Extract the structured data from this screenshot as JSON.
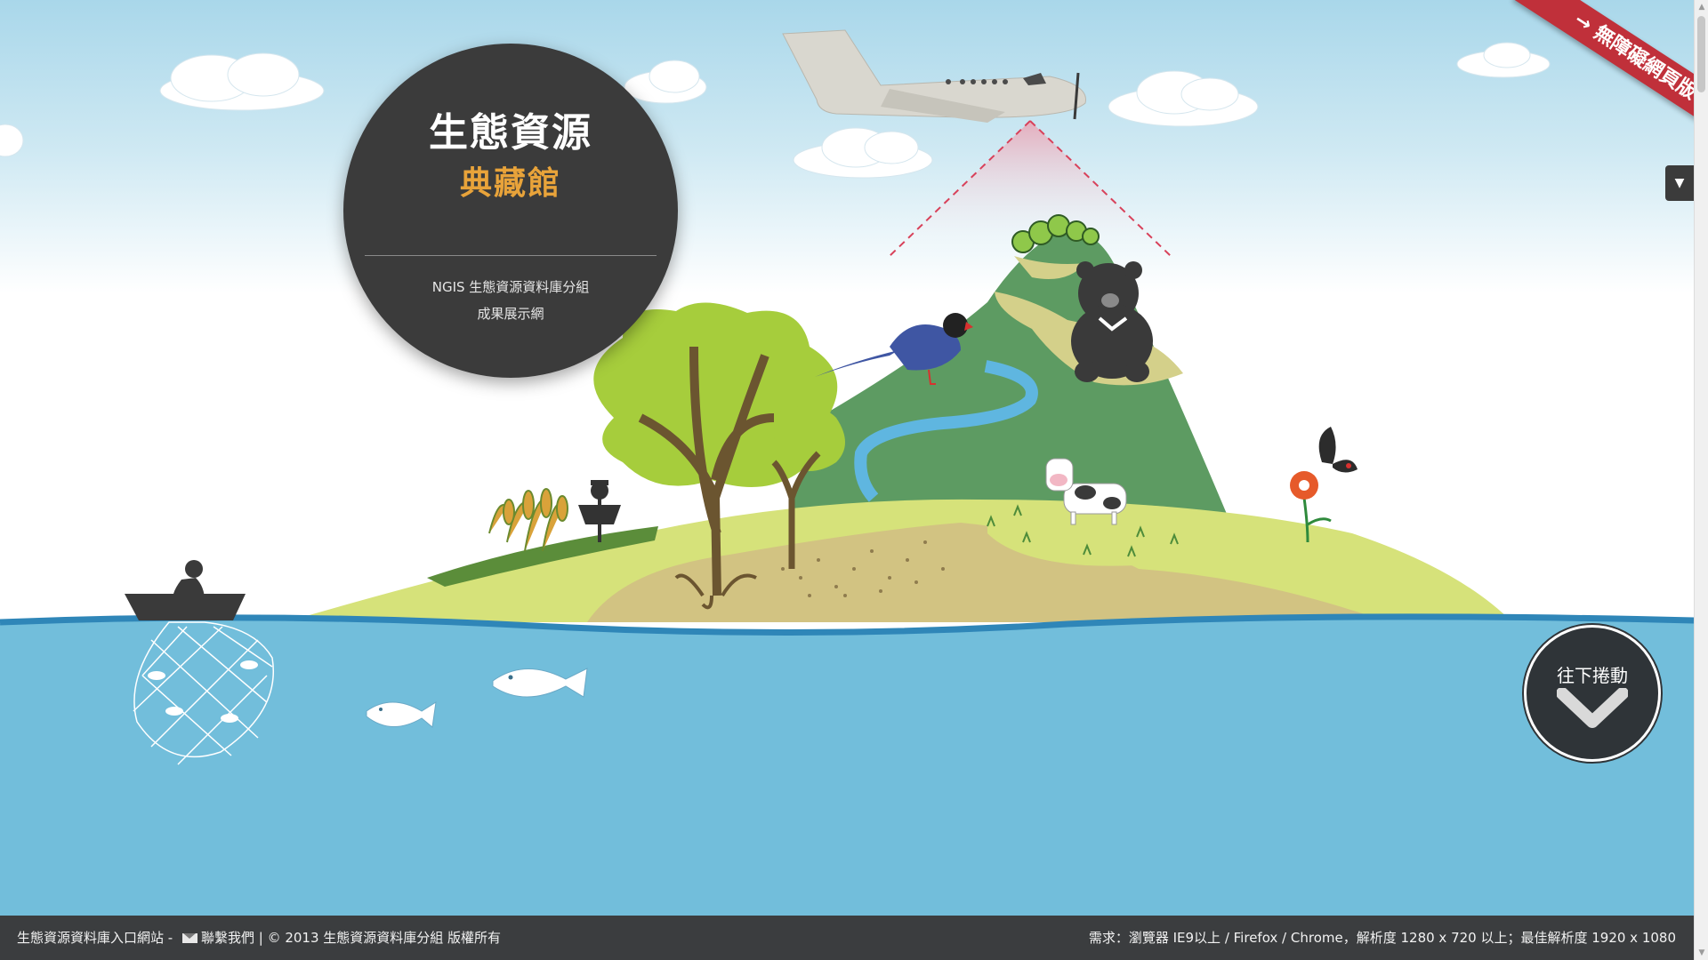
{
  "title": {
    "main": "生態資源",
    "sub": "典藏館",
    "desc_line1": "NGIS 生態資源資料庫分組",
    "desc_line2": "成果展示網"
  },
  "ribbon": {
    "label": "無障礙網頁版",
    "arrow": "→"
  },
  "side_tab": {
    "icon": "▼"
  },
  "scroll_button": {
    "label": "往下捲動",
    "icon": "chevron-down-icon"
  },
  "footer": {
    "portal_link": "生態資源資料庫入口網站",
    "separator1": " - ",
    "contact_link": "聯繫我們",
    "separator2": " | ",
    "copyright": "© 2013 生態資源資料庫分組 版權所有",
    "requirements": "需求：瀏覽器 IE9以上 / Firefox / Chrome，解析度 1280 x 720 以上；最佳解析度 1920 x 1080"
  },
  "colors": {
    "sea": "#72bedb",
    "sea_line": "#2f86b8",
    "title_bg": "#3b3b3b",
    "title_accent": "#e8a33a",
    "ribbon": "#c0303a",
    "footer_bg": "#3b3d3f",
    "island_light": "#d6e27a",
    "island_sand": "#d2c382",
    "mountain": "#5d9b62"
  }
}
